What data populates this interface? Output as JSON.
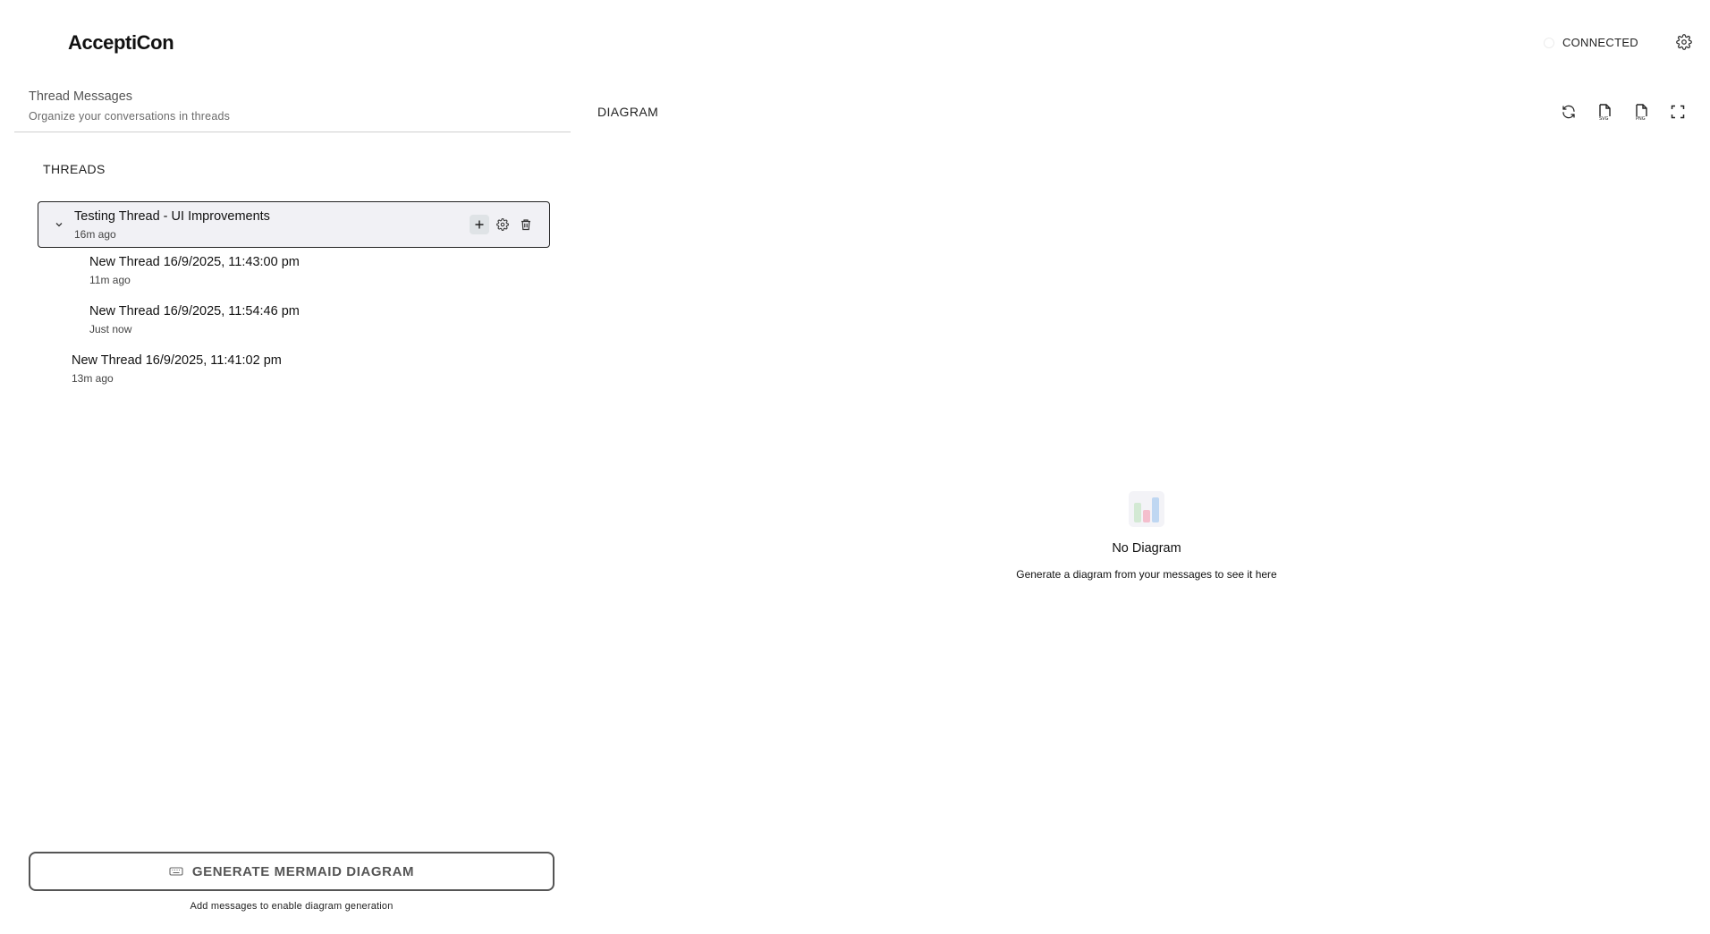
{
  "app": {
    "title": "AcceptiCon"
  },
  "header": {
    "connection_status": "CONNECTED"
  },
  "left_panel": {
    "title": "Thread Messages",
    "subtitle": "Organize your conversations in threads",
    "threads_label": "THREADS",
    "threads": [
      {
        "title": "Testing Thread - UI Improvements",
        "time": "16m ago",
        "expanded": true,
        "children": [
          {
            "title": "New Thread 16/9/2025, 11:43:00 pm",
            "time": "11m ago"
          },
          {
            "title": "New Thread 16/9/2025, 11:54:46 pm",
            "time": "Just now"
          }
        ]
      },
      {
        "title": "New Thread 16/9/2025, 11:41:02 pm",
        "time": "13m ago"
      }
    ],
    "generate_button": "GENERATE MERMAID DIAGRAM",
    "generate_hint": "Add messages to enable diagram generation"
  },
  "right_panel": {
    "label": "DIAGRAM",
    "toolbar_icons": [
      "refresh-icon",
      "export-svg-icon",
      "export-png-icon",
      "fullscreen-icon"
    ],
    "empty_title": "No Diagram",
    "empty_subtitle": "Generate a diagram from your messages to see it here"
  },
  "colors": {
    "selected_thread_bg": "#f1f1f5",
    "border_dark": "#222222",
    "button_text": "#555555"
  }
}
